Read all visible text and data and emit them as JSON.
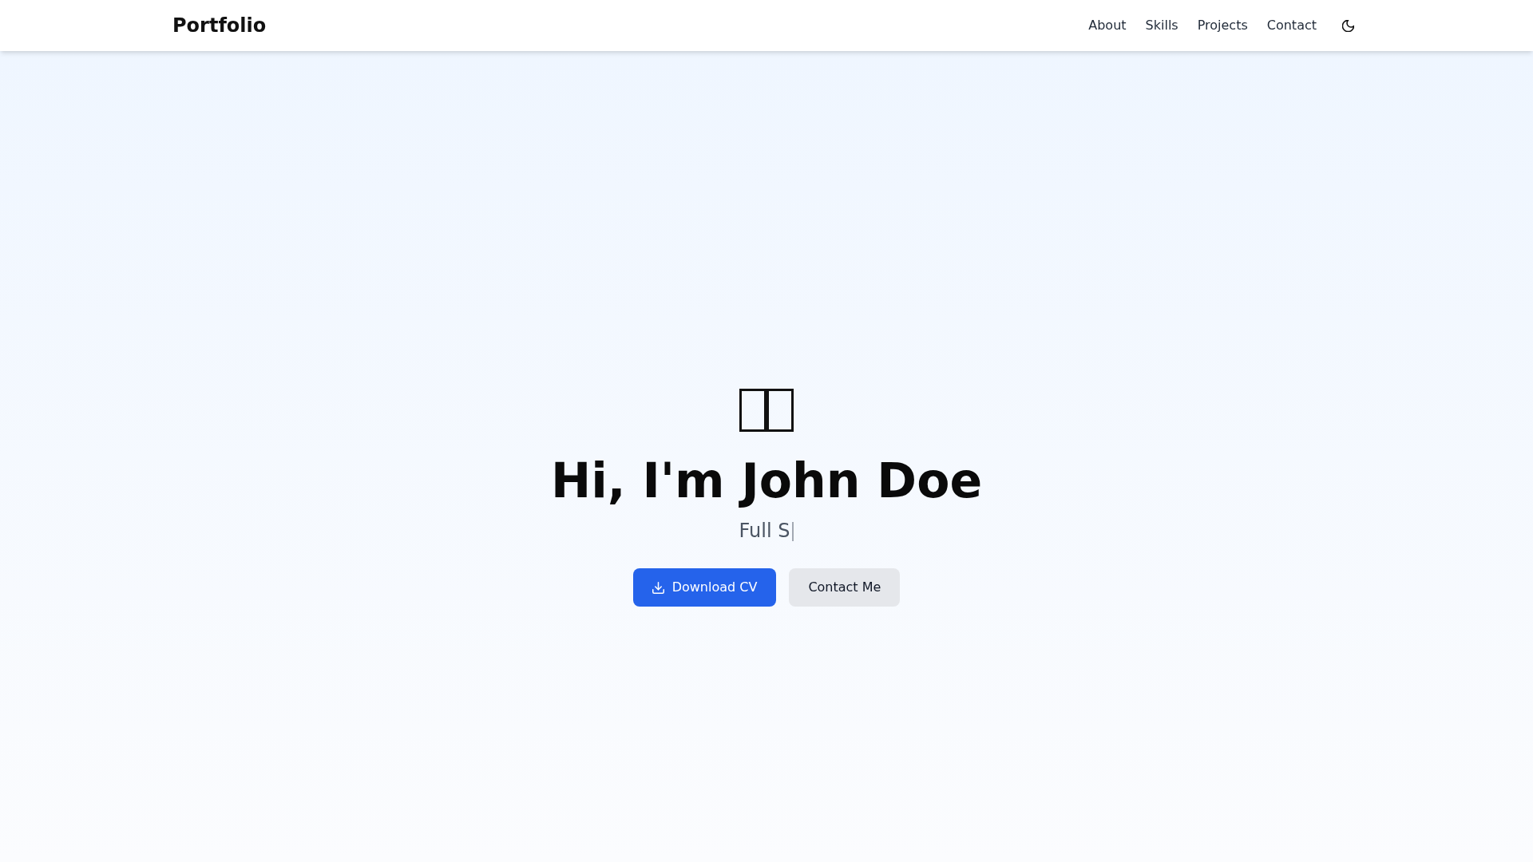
{
  "header": {
    "logo": "Portfolio",
    "nav_links": [
      "About",
      "Skills",
      "Projects",
      "Contact"
    ]
  },
  "hero": {
    "greeting": "Hi, I'm John Doe",
    "typed_text": "Full S",
    "buttons": [
      {
        "label": "Download CV",
        "kind": "download"
      },
      {
        "label": "Contact Me",
        "kind": "contact"
      }
    ]
  }
}
